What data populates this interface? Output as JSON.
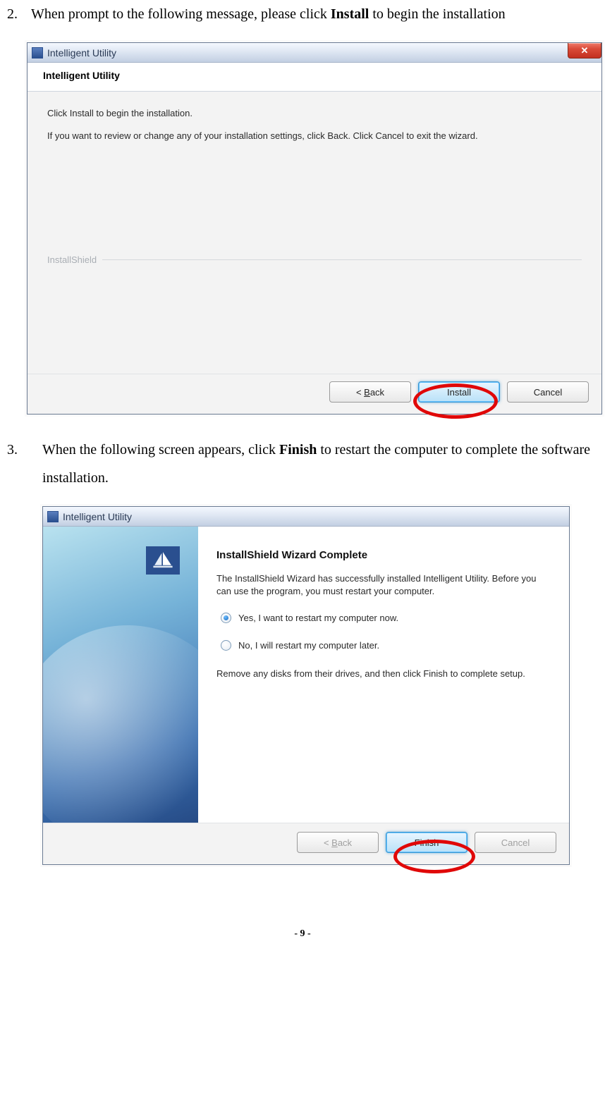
{
  "step2": {
    "num": "2.",
    "text_before": "When prompt to the following message, please click ",
    "bold": "Install",
    "text_after": " to begin the installation"
  },
  "dialog1": {
    "title": "Intelligent Utility",
    "header": "Intelligent Utility",
    "line1": "Click Install to begin the installation.",
    "line2": "If you want to review or change any of your installation settings, click Back. Click Cancel to exit the wizard.",
    "installshield_label": "InstallShield",
    "back": "< Back",
    "install": "Install",
    "cancel": "Cancel"
  },
  "step3": {
    "num": "3.",
    "text_before": "When the following screen appears, click ",
    "bold": "Finish",
    "text_after": " to restart the computer to complete the software installation."
  },
  "dialog2": {
    "title": "Intelligent Utility",
    "heading": "InstallShield Wizard Complete",
    "para1": "The InstallShield Wizard has successfully installed Intelligent Utility.  Before you can use the program, you must restart your computer.",
    "radio_yes": "Yes, I want to restart my computer now.",
    "radio_no": "No, I will restart my computer later.",
    "para2": "Remove any disks from their drives, and then click Finish to complete setup.",
    "back": "< Back",
    "finish": "Finish",
    "cancel": "Cancel"
  },
  "page_number": "- 9 -"
}
